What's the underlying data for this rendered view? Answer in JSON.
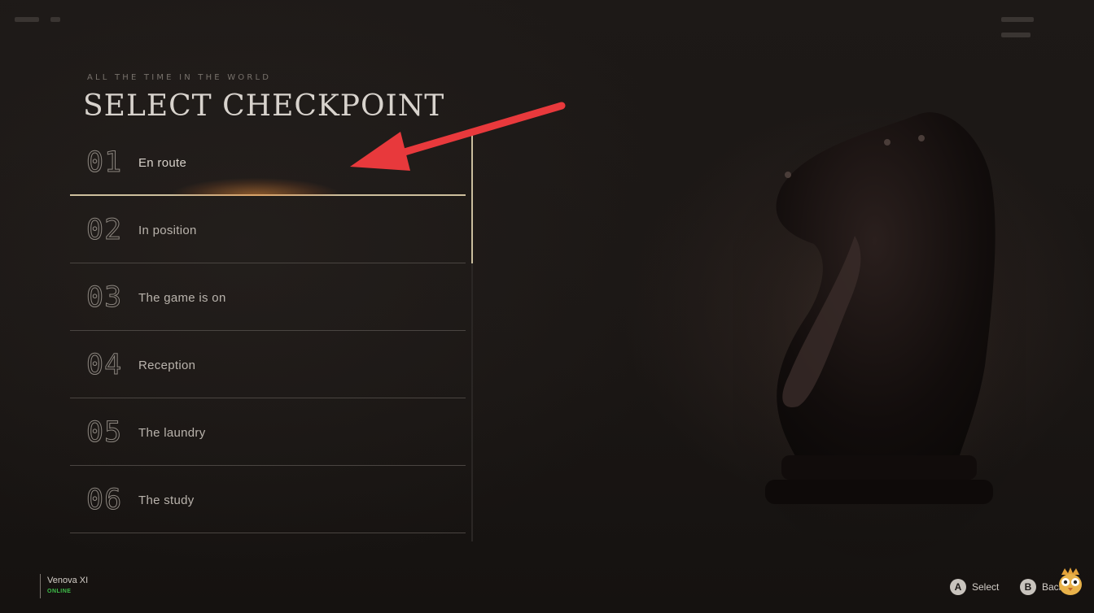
{
  "screen": {
    "subtitle": "ALL THE TIME IN THE WORLD",
    "title": "SELECT CHECKPOINT"
  },
  "checkpoints": [
    {
      "number": "01",
      "label": "En route",
      "selected": true
    },
    {
      "number": "02",
      "label": "In position",
      "selected": false
    },
    {
      "number": "03",
      "label": "The game is on",
      "selected": false
    },
    {
      "number": "04",
      "label": "Reception",
      "selected": false
    },
    {
      "number": "05",
      "label": "The laundry",
      "selected": false
    },
    {
      "number": "06",
      "label": "The study",
      "selected": false
    }
  ],
  "player": {
    "name": "Venova XI",
    "status": "ONLINE",
    "status_color": "#3fbf4a"
  },
  "prompts": [
    {
      "button": "A",
      "label": "Select"
    },
    {
      "button": "B",
      "label": "Back"
    }
  ],
  "colors": {
    "accent": "#cdbf9d",
    "annotation_arrow": "#e8393c",
    "background": "#1b1715"
  },
  "icons": {
    "background_art": "chess-knight-icon",
    "channel_logo": "owl-mascot-icon"
  }
}
